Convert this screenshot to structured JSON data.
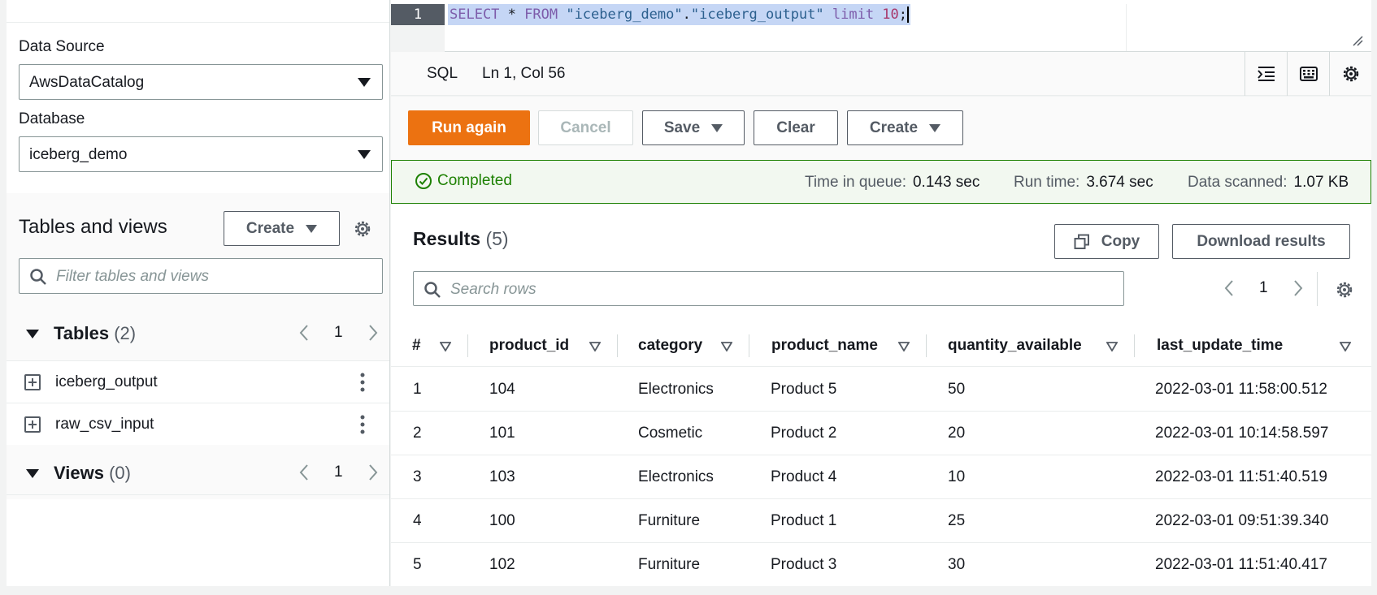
{
  "sidebar": {
    "data_source_label": "Data Source",
    "data_source_value": "AwsDataCatalog",
    "database_label": "Database",
    "database_value": "iceberg_demo",
    "tables_and_views_title": "Tables and views",
    "create_label": "Create",
    "filter_placeholder": "Filter tables and views",
    "tables": {
      "label": "Tables",
      "count": "(2)",
      "page": "1",
      "items": [
        "iceberg_output",
        "raw_csv_input"
      ]
    },
    "views": {
      "label": "Views",
      "count": "(0)",
      "page": "1"
    }
  },
  "editor": {
    "line_number": "1",
    "query_parts": {
      "kw1": "SELECT",
      "star": " * ",
      "kw2": "FROM",
      "db": " \"iceberg_demo\"",
      "dot": ".",
      "table": "\"iceberg_output\"",
      "kw3": " limit ",
      "limit": "10",
      "semi": ";"
    },
    "language": "SQL",
    "cursor_pos": "Ln 1, Col 56"
  },
  "actions": {
    "run_again": "Run again",
    "cancel": "Cancel",
    "save": "Save",
    "clear": "Clear",
    "create": "Create"
  },
  "status": {
    "state": "Completed",
    "time_in_queue_label": "Time in queue:",
    "time_in_queue_value": "0.143 sec",
    "run_time_label": "Run time:",
    "run_time_value": "3.674 sec",
    "data_scanned_label": "Data scanned:",
    "data_scanned_value": "1.07 KB"
  },
  "results": {
    "title": "Results",
    "count": "(5)",
    "copy_label": "Copy",
    "download_label": "Download results",
    "search_placeholder": "Search rows",
    "page": "1",
    "columns": [
      "#",
      "product_id",
      "category",
      "product_name",
      "quantity_available",
      "last_update_time"
    ],
    "rows": [
      [
        "1",
        "104",
        "Electronics",
        "Product 5",
        "50",
        "2022-03-01 11:58:00.512"
      ],
      [
        "2",
        "101",
        "Cosmetic",
        "Product 2",
        "20",
        "2022-03-01 10:14:58.597"
      ],
      [
        "3",
        "103",
        "Electronics",
        "Product 4",
        "10",
        "2022-03-01 11:51:40.519"
      ],
      [
        "4",
        "100",
        "Furniture",
        "Product 1",
        "25",
        "2022-03-01 09:51:39.340"
      ],
      [
        "5",
        "102",
        "Furniture",
        "Product 3",
        "30",
        "2022-03-01 11:51:40.417"
      ]
    ]
  },
  "colors": {
    "primary": "#ec7211",
    "success": "#1d8102",
    "border": "#879596",
    "text": "#16191f"
  }
}
